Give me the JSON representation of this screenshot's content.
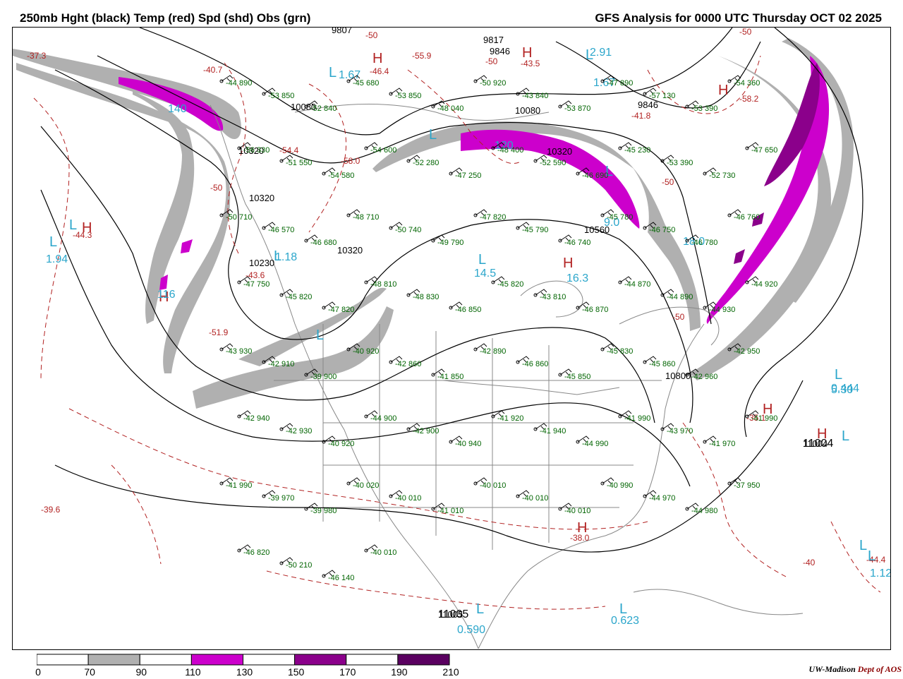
{
  "header": {
    "left_title": "250mb Hght (black) Temp (red) Spd (shd) Obs (grn)",
    "right_title": "GFS Analysis for 0000 UTC Thursday  OCT 02 2025"
  },
  "credit": {
    "org": "UW-Madison",
    "dept": "Dept of AOS"
  },
  "colorbar": {
    "labels": [
      "0",
      "70",
      "90",
      "110",
      "130",
      "150",
      "170",
      "190",
      "210"
    ],
    "colors": [
      "#ffffff",
      "#b0b0b0",
      "#ffffff",
      "#cc00cc",
      "#ffffff",
      "#8b008b",
      "#ffffff",
      "#5a0060"
    ]
  },
  "colors": {
    "height": "#000000",
    "temp": "#b22222",
    "speed_gray": "#b0b0b0",
    "speed_magenta": "#cc00cc",
    "speed_purple": "#8b008b",
    "obs": "#006400",
    "extrema_cyan": "#2ba6cb",
    "map_lines": "#888888"
  },
  "height_labels": [
    "9807",
    "9817",
    "9846",
    "10080",
    "10080",
    "10320",
    "10320",
    "10320",
    "10320",
    "10560",
    "10800",
    "10230",
    "9846",
    "11004",
    "11005"
  ],
  "temp_labels": [
    "-37.3",
    "-40.7",
    "-50",
    "-46.4",
    "-55.9",
    "-43.5",
    "-50",
    "-58.2",
    "-41.8",
    "-54.4",
    "-58.0",
    "-50",
    "-44.3",
    "-43.6",
    "-51.9",
    "-50",
    "-35.1",
    "-39.6",
    "-38.0",
    "-44.4",
    "-40",
    "-50",
    "-50"
  ],
  "extrema_labels": [
    "H",
    "L",
    "H",
    "L",
    "H",
    "L",
    "H",
    "L",
    "H",
    "L",
    "H",
    "L",
    "H",
    "L",
    "L",
    "L",
    "L",
    "L",
    "H",
    "L",
    "H",
    "L",
    "L",
    "L"
  ],
  "extrema_values": [
    "2.91",
    "1.67",
    "1.67",
    "140",
    "120",
    "9.0",
    "18.0",
    "1.94",
    "116",
    "14.5",
    "16.3",
    "5.30",
    "0.444",
    "0.590",
    "0.623",
    "1.12",
    "1.18",
    "11004",
    "11005"
  ],
  "obs_labels": [
    "-44 890",
    "-53 850",
    "-52 840",
    "-45 680",
    "-53 850",
    "-48 040",
    "-50 920",
    "-43 840",
    "-53 870",
    "-47 890",
    "-57 130",
    "-53 390",
    "-54 360",
    "-56 330",
    "-51 550",
    "-54 580",
    "-54 600",
    "-52 280",
    "-47 250",
    "-48 400",
    "-52 590",
    "-46 690",
    "-45 230",
    "-53 390",
    "-52 730",
    "-47 650",
    "-50 710",
    "-46 570",
    "-46 680",
    "-48 710",
    "-50 740",
    "-49 790",
    "-47 820",
    "-45 790",
    "-46 740",
    "-45 780",
    "-46 750",
    "-46 780",
    "-46 760",
    "-47 750",
    "-45 820",
    "-47 820",
    "-48 810",
    "-48 830",
    "-46 850",
    "-45 820",
    "-43 810",
    "-46 870",
    "-44 870",
    "-44 890",
    "-44 930",
    "-44 920",
    "-43 930",
    "-42 910",
    "-39 900",
    "-40 920",
    "-42 860",
    "-41 850",
    "-42 890",
    "-46 860",
    "-45 850",
    "-45 830",
    "-45 860",
    "-42 960",
    "-42 950",
    "-42 940",
    "-42 930",
    "-40 920",
    "-44 900",
    "-42 900",
    "-40 940",
    "-41 920",
    "-41 940",
    "-44 990",
    "-41 990",
    "-43 970",
    "-41 970",
    "-41 990",
    "-41 990",
    "-39 970",
    "-39 980",
    "-40 020",
    "-40 010",
    "-41 010",
    "-40 010",
    "-40 010",
    "-40 010",
    "-40 990",
    "-44 970",
    "-44 980",
    "-37 950",
    "-46 820",
    "-50 210",
    "-46 140",
    "-40 010"
  ],
  "map": {
    "description_not_shown": ""
  }
}
